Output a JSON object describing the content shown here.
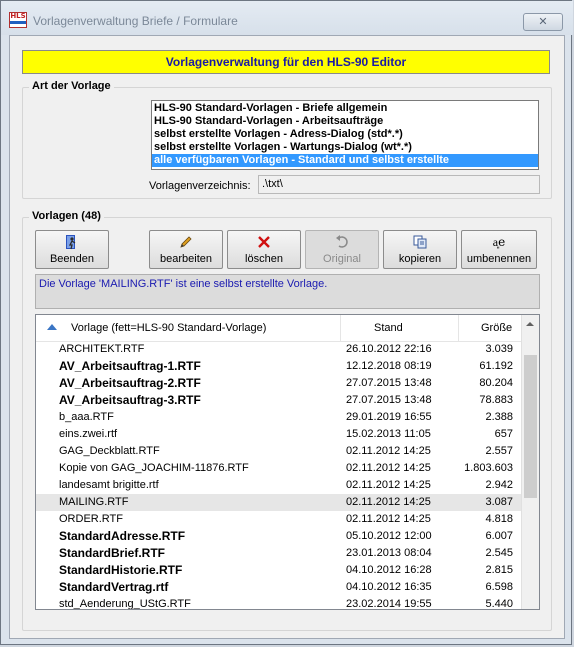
{
  "window": {
    "title": "Vorlagenverwaltung Briefe / Formulare",
    "icon_text": "HLS",
    "close_symbol": "✕"
  },
  "banner": "Vorlagenverwaltung für den HLS-90 Editor",
  "art_group": {
    "label": "Art der Vorlage",
    "items": [
      "HLS-90 Standard-Vorlagen - Briefe allgemein",
      "HLS-90 Standard-Vorlagen - Arbeitsaufträge",
      "selbst erstellte Vorlagen - Adress-Dialog (std*.*)",
      "selbst erstellte Vorlagen - Wartungs-Dialog (wt*.*)",
      "alle verfügbaren Vorlagen - Standard und selbst erstellte"
    ],
    "selected_index": 4,
    "dir_label": "Vorlagenverzeichnis:",
    "dir_value": ".\\txt\\"
  },
  "vorlagen_group": {
    "label": "Vorlagen (48)"
  },
  "toolbar": {
    "beenden": {
      "label": "Beenden",
      "icon": "exit-door-icon"
    },
    "bearbeiten": {
      "label": "bearbeiten",
      "icon": "pencil-icon"
    },
    "loeschen": {
      "label": "löschen",
      "icon": "red-x-icon"
    },
    "original": {
      "label": "Original",
      "icon": "undo-icon"
    },
    "kopieren": {
      "label": "kopieren",
      "icon": "copy-icon"
    },
    "umbenennen": {
      "label": "umbenennen",
      "icon": "rename-icon",
      "glyph": "a͈e"
    }
  },
  "info_text": "Die Vorlage 'MAILING.RTF' ist eine selbst erstellte Vorlage.",
  "table": {
    "col_name": "Vorlage    (fett=HLS-90 Standard-Vorlage)",
    "col_stand": "Stand",
    "col_size": "Größe",
    "rows": [
      {
        "name": "ARCHITEKT.RTF",
        "stand": "26.10.2012 22:16",
        "size": "3.039",
        "bold": false
      },
      {
        "name": "AV_Arbeitsauftrag-1.RTF",
        "stand": "12.12.2018 08:19",
        "size": "61.192",
        "bold": true
      },
      {
        "name": "AV_Arbeitsauftrag-2.RTF",
        "stand": "27.07.2015 13:48",
        "size": "80.204",
        "bold": true
      },
      {
        "name": "AV_Arbeitsauftrag-3.RTF",
        "stand": "27.07.2015 13:48",
        "size": "78.883",
        "bold": true
      },
      {
        "name": "b_aaa.RTF",
        "stand": "29.01.2019 16:55",
        "size": "2.388",
        "bold": false
      },
      {
        "name": "eins.zwei.rtf",
        "stand": "15.02.2013 11:05",
        "size": "657",
        "bold": false
      },
      {
        "name": "GAG_Deckblatt.RTF",
        "stand": "02.11.2012 14:25",
        "size": "2.557",
        "bold": false
      },
      {
        "name": "Kopie von GAG_JOACHIM-11876.RTF",
        "stand": "02.11.2012 14:25",
        "size": "1.803.603",
        "bold": false
      },
      {
        "name": "landesamt brigitte.rtf",
        "stand": "02.11.2012 14:25",
        "size": "2.942",
        "bold": false
      },
      {
        "name": "MAILING.RTF",
        "stand": "02.11.2012 14:25",
        "size": "3.087",
        "bold": false,
        "selected": true
      },
      {
        "name": "ORDER.RTF",
        "stand": "02.11.2012 14:25",
        "size": "4.818",
        "bold": false
      },
      {
        "name": "StandardAdresse.RTF",
        "stand": "05.10.2012 12:00",
        "size": "6.007",
        "bold": true
      },
      {
        "name": "StandardBrief.RTF",
        "stand": "23.01.2013 08:04",
        "size": "2.545",
        "bold": true
      },
      {
        "name": "StandardHistorie.RTF",
        "stand": "04.10.2012 16:28",
        "size": "2.815",
        "bold": true
      },
      {
        "name": "StandardVertrag.rtf",
        "stand": "04.10.2012 16:35",
        "size": "6.598",
        "bold": true
      },
      {
        "name": "std_Aenderung_UStG.RTF",
        "stand": "23.02.2014 19:55",
        "size": "5.440",
        "bold": false
      }
    ]
  }
}
